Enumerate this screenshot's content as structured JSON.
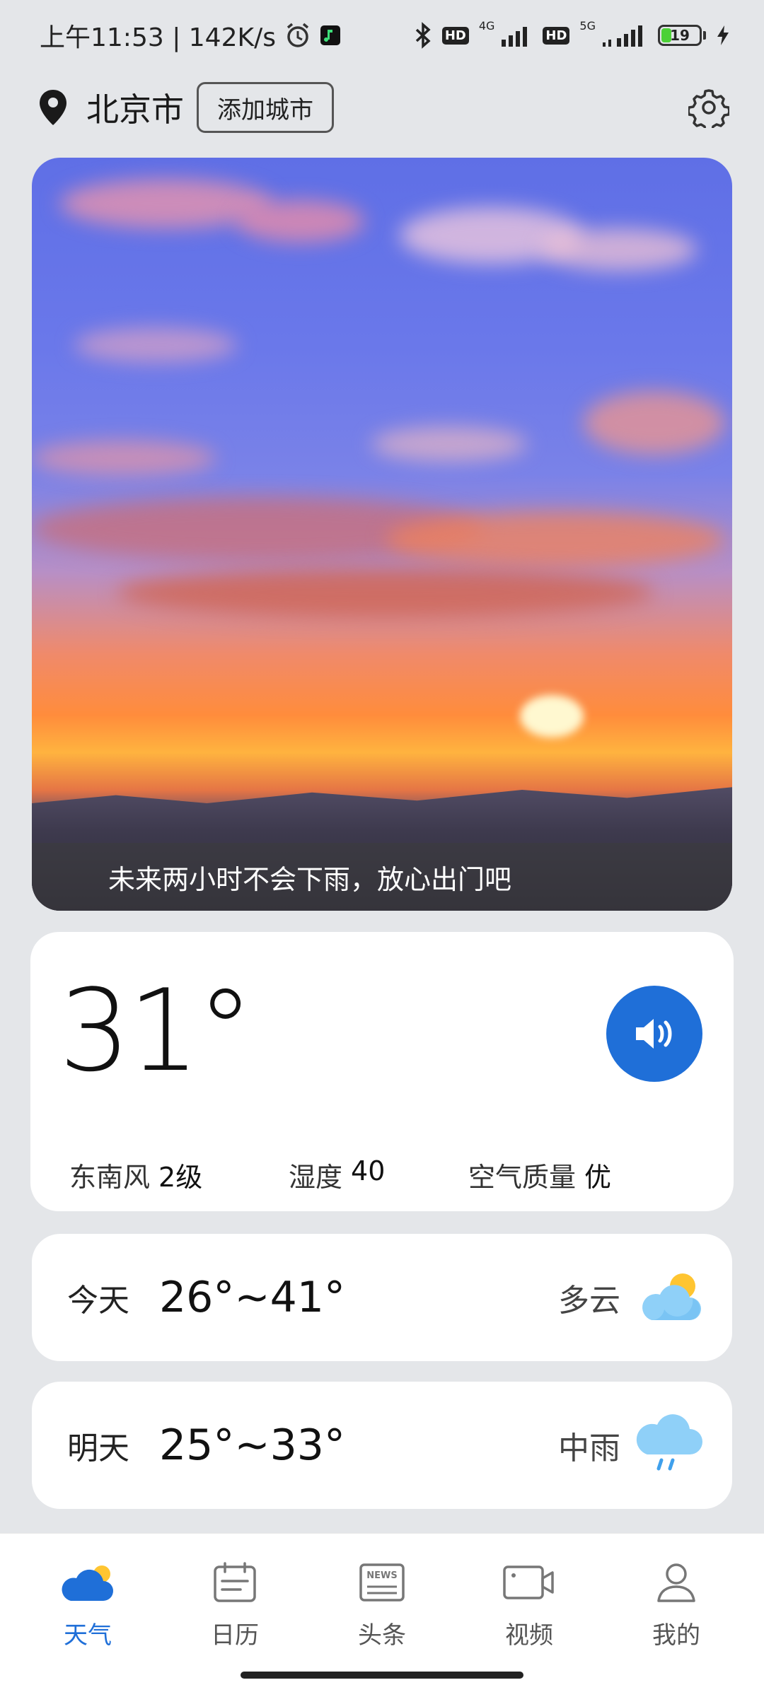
{
  "status_bar": {
    "time_speed": "上午11:53 | 142K/s",
    "net_4g": "4G",
    "net_5g": "5G",
    "hd": "HD",
    "battery": "19"
  },
  "header": {
    "city": "北京市",
    "add_city_label": "添加城市"
  },
  "hero": {
    "banner_text": "未来两小时不会下雨，放心出门吧"
  },
  "current": {
    "temperature": "31°",
    "wind_label": "东南风",
    "wind_value": "2级",
    "humidity_label": "湿度",
    "humidity_value": "40",
    "aqi_label": "空气质量",
    "aqi_value": "优"
  },
  "forecast": [
    {
      "day": "今天",
      "range": "26°~41°",
      "condition": "多云",
      "icon": "partly-cloudy-icon"
    },
    {
      "day": "明天",
      "range": "25°~33°",
      "condition": "中雨",
      "icon": "rain-icon"
    }
  ],
  "nav": [
    {
      "label": "天气",
      "icon": "weather-icon",
      "active": true
    },
    {
      "label": "日历",
      "icon": "calendar-icon",
      "active": false
    },
    {
      "label": "头条",
      "icon": "news-icon",
      "active": false
    },
    {
      "label": "视频",
      "icon": "video-icon",
      "active": false
    },
    {
      "label": "我的",
      "icon": "profile-icon",
      "active": false
    }
  ],
  "news_icon_text": "NEWS",
  "colors": {
    "accent": "#1f6fd8",
    "background": "#e4e6e9"
  }
}
